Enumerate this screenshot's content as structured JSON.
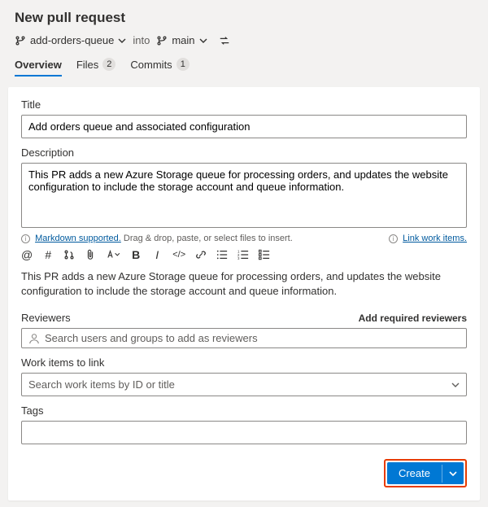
{
  "page_title": "New pull request",
  "branches": {
    "source": "add-orders-queue",
    "into": "into",
    "target": "main"
  },
  "tabs": {
    "overview": "Overview",
    "files": "Files",
    "files_count": "2",
    "commits": "Commits",
    "commits_count": "1"
  },
  "form": {
    "title_label": "Title",
    "title_value": "Add orders queue and associated configuration",
    "description_label": "Description",
    "description_value": "This PR adds a new Azure Storage queue for processing orders, and updates the website configuration to include the storage account and queue information.",
    "markdown_link": "Markdown supported.",
    "drag_hint": "Drag & drop, paste, or select files to insert.",
    "link_work_items": "Link work items.",
    "preview_text": "This PR adds a new Azure Storage queue for processing orders, and updates the website configuration to include the storage account and queue information.",
    "reviewers_label": "Reviewers",
    "add_required": "Add required reviewers",
    "reviewers_placeholder": "Search users and groups to add as reviewers",
    "work_items_label": "Work items to link",
    "work_items_placeholder": "Search work items by ID or title",
    "tags_label": "Tags",
    "create_label": "Create"
  },
  "toolbar_glyphs": {
    "mention": "@",
    "hash": "#",
    "pr": "⎇",
    "attach": "📎",
    "paint": "✎",
    "bold": "B",
    "italic": "I",
    "code": "</>",
    "link": "🔗",
    "ul": "≡",
    "ol": "≣",
    "task": "☰"
  }
}
